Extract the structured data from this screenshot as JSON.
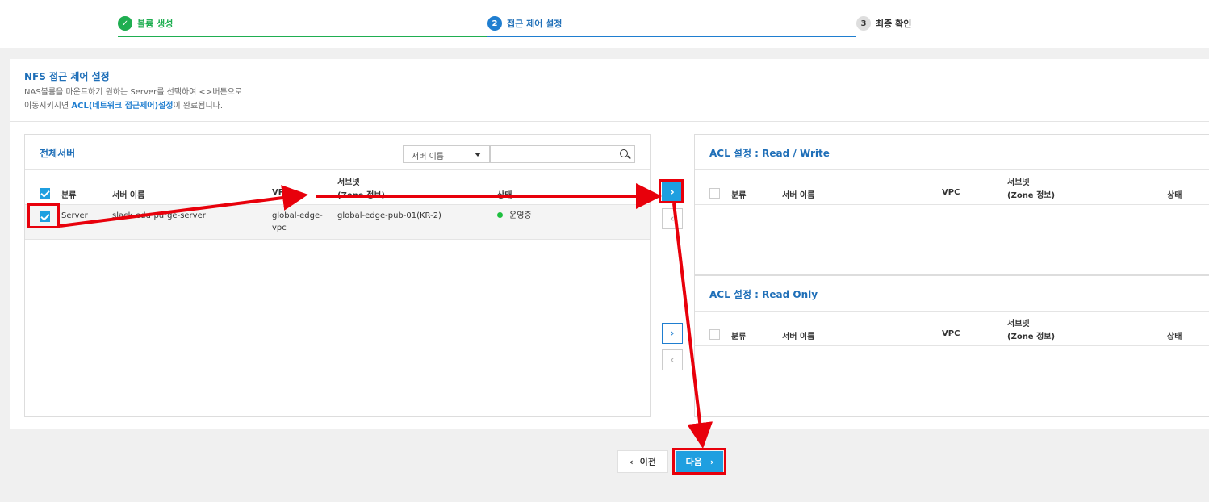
{
  "stepper": {
    "steps": [
      {
        "num": "✓",
        "label": "볼륨 생성"
      },
      {
        "num": "2",
        "label": "접근 제어 설정"
      },
      {
        "num": "3",
        "label": "최종 확인"
      }
    ]
  },
  "header": {
    "title": "NFS 접근 제어 설정",
    "desc_line1": "NAS볼륨을 마운트하기 원하는 Server를 선택하여 <>버튼으로",
    "desc_line2_pre": "이동시키시면 ",
    "desc_line2_hl": "ACL(네트워크 접근제어)설정",
    "desc_line2_post": "이 완료됩니다."
  },
  "server_list": {
    "title": "전체서버",
    "search_select": "서버 이름",
    "search_value": "",
    "columns": {
      "type": "분류",
      "name": "서버 이름",
      "vpc": "VPC",
      "subnet1": "서브넷",
      "subnet2": "(Zone 정보)",
      "status": "상태"
    },
    "rows": [
      {
        "type": "Server",
        "name": "slack-edu-purge-server",
        "vpc1": "global-edge-",
        "vpc2": "vpc",
        "subnet": "global-edge-pub-01(KR-2)",
        "status": "운영중"
      }
    ]
  },
  "acl_rw": {
    "title": "ACL 설정 : Read / Write",
    "columns": {
      "type": "분류",
      "name": "서버 이름",
      "vpc": "VPC",
      "subnet1": "서브넷",
      "subnet2": "(Zone 정보)",
      "status": "상태"
    }
  },
  "acl_ro": {
    "title": "ACL 설정 : Read Only",
    "columns": {
      "type": "분류",
      "name": "서버 이름",
      "vpc": "VPC",
      "subnet1": "서브넷",
      "subnet2": "(Zone 정보)",
      "status": "상태"
    }
  },
  "buttons": {
    "prev": "이전",
    "next": "다음",
    "move_right": "›",
    "move_left": "‹",
    "prev_chevron": "‹",
    "next_chevron": "›"
  },
  "colors": {
    "accent": "#1f9fe0",
    "success": "#1fae51",
    "annotation": "#e8000b"
  }
}
